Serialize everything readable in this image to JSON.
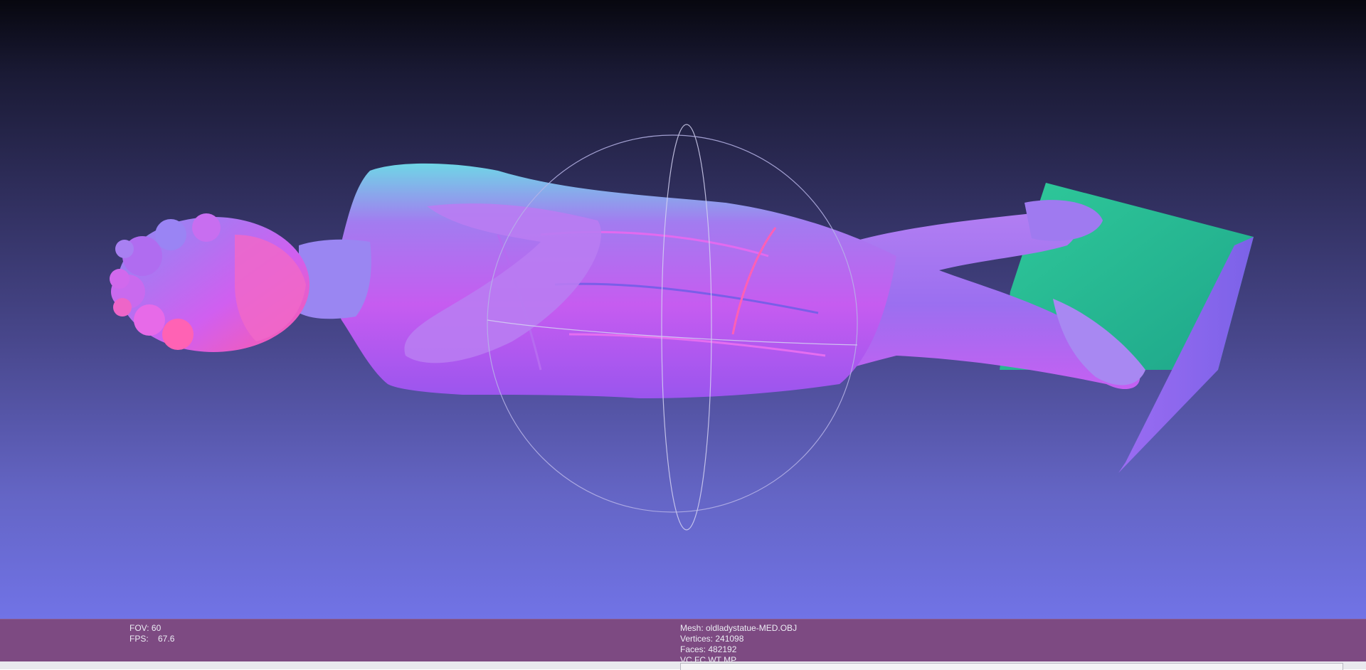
{
  "viewer": {
    "background_top": "#07070f",
    "background_bottom": "#7173e6",
    "info_bar_color": "#7d4a82",
    "shading": "normal-map"
  },
  "info": {
    "left": {
      "fov": "FOV: 60",
      "fps": "FPS:    67.6"
    },
    "center": {
      "mesh": "Mesh: oldladystatue-MED.OBJ",
      "vertices": "Vertices: 241098",
      "faces": "Faces: 482192",
      "flags": "VC FC WT MP"
    }
  },
  "icons": {
    "trackball": "trackball-icon",
    "model": "statue-model"
  }
}
